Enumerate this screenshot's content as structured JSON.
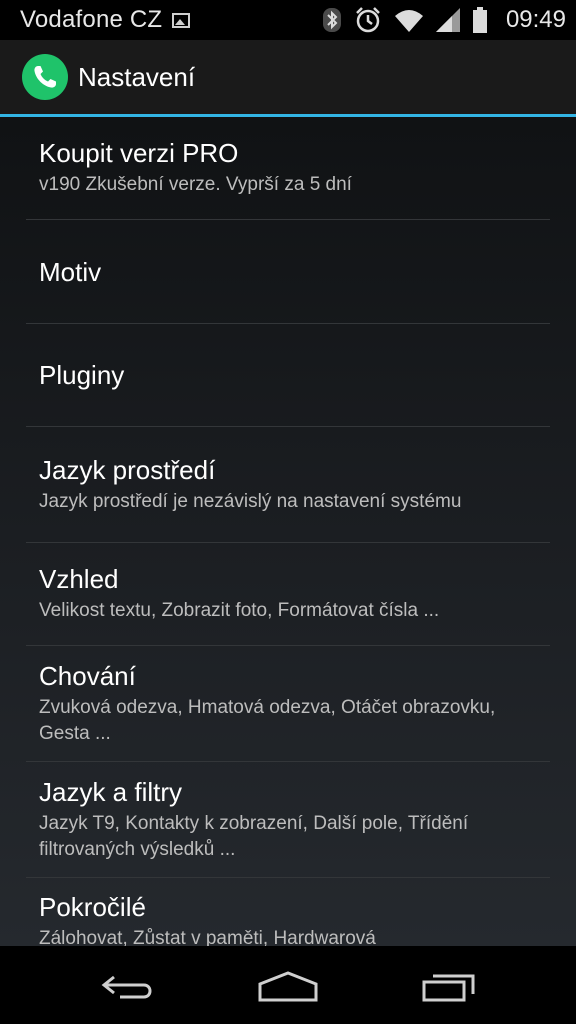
{
  "status_bar": {
    "carrier": "Vodafone CZ",
    "time": "09:49",
    "icons": [
      "gallery-icon",
      "bluetooth-icon",
      "alarm-icon",
      "wifi-icon",
      "signal-icon",
      "battery-icon"
    ]
  },
  "action_bar": {
    "title": "Nastavení",
    "app_icon": "phone-icon",
    "accent_color": "#33b5e5",
    "icon_color": "#1fc36a"
  },
  "settings": {
    "items": [
      {
        "title": "Koupit verzi PRO",
        "subtitle": "v190 Zkušební verze. Vyprší za 5 dní"
      },
      {
        "title": "Motiv",
        "subtitle": ""
      },
      {
        "title": "Pluginy",
        "subtitle": ""
      },
      {
        "title": "Jazyk prostředí",
        "subtitle": "Jazyk prostředí je nezávislý na nastavení systému"
      },
      {
        "title": "Vzhled",
        "subtitle": "Velikost textu, Zobrazit foto, Formátovat čísla ..."
      },
      {
        "title": "Chování",
        "subtitle": "Zvuková odezva, Hmatová odezva, Otáčet obrazovku, Gesta ..."
      },
      {
        "title": "Jazyk a filtry",
        "subtitle": "Jazyk T9, Kontakty k zobrazení, Další pole, Třídění filtrovaných výsledků ..."
      },
      {
        "title": "Pokročilé",
        "subtitle": "Zálohovat, Zůstat v paměti, Hardwarová"
      }
    ]
  },
  "nav_bar": {
    "icons": [
      "back-icon",
      "home-icon",
      "recent-apps-icon"
    ]
  }
}
